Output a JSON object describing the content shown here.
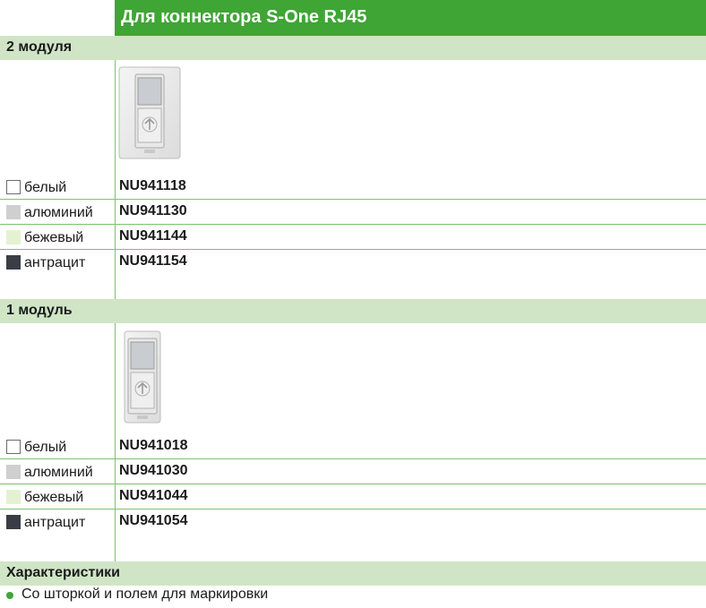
{
  "header": {
    "title": "Для коннектора S-One RJ45"
  },
  "sections": [
    {
      "title": "2 модуля",
      "variants": [
        {
          "color": "белый",
          "code": "NU941118",
          "swatch": "#ffffff"
        },
        {
          "color": "алюминий",
          "code": "NU941130",
          "swatch": "#cfcfcf"
        },
        {
          "color": "бежевый",
          "code": "NU941144",
          "swatch": "#e4f2d2"
        },
        {
          "color": "антрацит",
          "code": "NU941154",
          "swatch": "#3a3d45"
        }
      ]
    },
    {
      "title": "1 модуль",
      "variants": [
        {
          "color": "белый",
          "code": "NU941018",
          "swatch": "#ffffff"
        },
        {
          "color": "алюминий",
          "code": "NU941030",
          "swatch": "#cfcfcf"
        },
        {
          "color": "бежевый",
          "code": "NU941044",
          "swatch": "#e4f2d2"
        },
        {
          "color": "антрацит",
          "code": "NU941054",
          "swatch": "#3a3d45"
        }
      ]
    }
  ],
  "characteristics": {
    "title": "Характеристики",
    "items": [
      "Со шторкой и полем для маркировки"
    ]
  },
  "colors": {
    "accent": "#3fa535",
    "section_bg": "#cfe5c6",
    "grid": "#7fc070"
  },
  "images": [
    "rj45-socket-2-module",
    "rj45-socket-1-module"
  ]
}
